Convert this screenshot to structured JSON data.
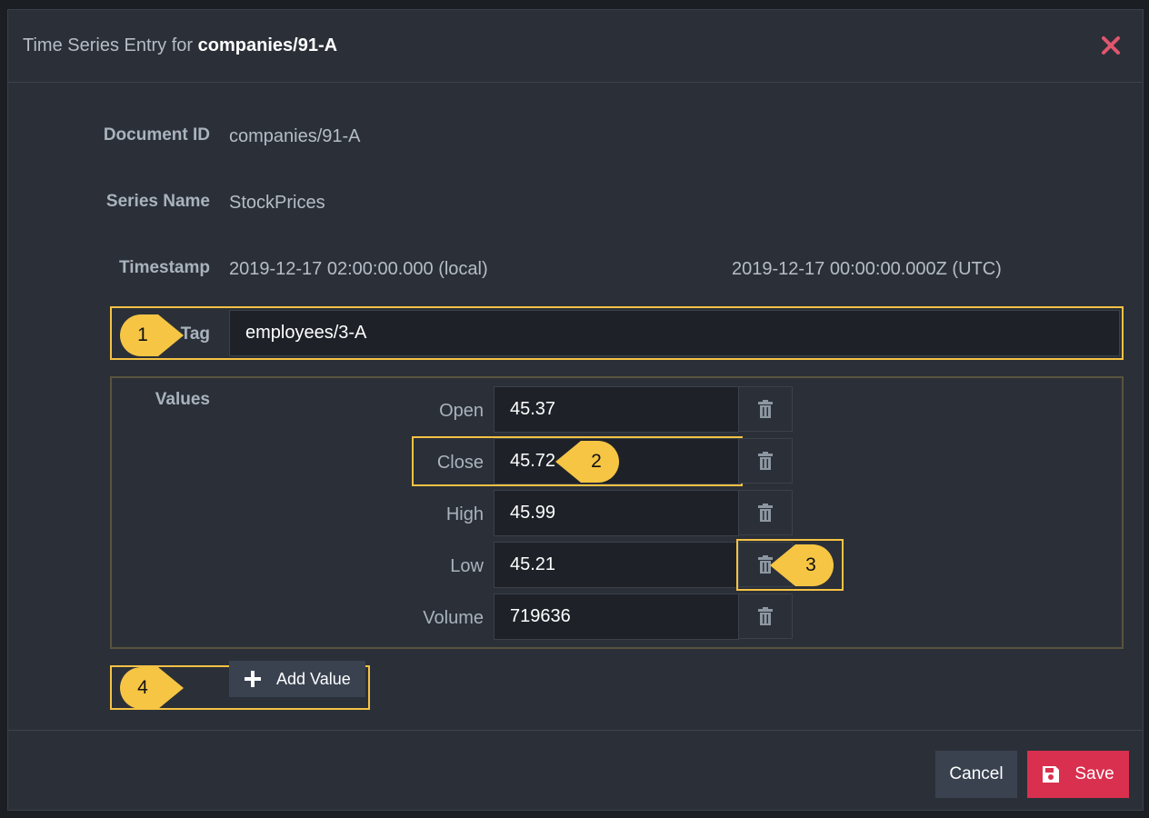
{
  "dialog": {
    "title_prefix": "Time Series Entry for",
    "title_doc": "companies/91-A",
    "close_icon": "close-icon"
  },
  "fields": {
    "document_id_label": "Document ID",
    "document_id_value": "companies/91-A",
    "series_name_label": "Series Name",
    "series_name_value": "StockPrices",
    "timestamp_label": "Timestamp",
    "timestamp_local": "2019-12-17 02:00:00.000 (local)",
    "timestamp_utc": "2019-12-17 00:00:00.000Z (UTC)",
    "tag_label": "Tag",
    "tag_value": "employees/3-A"
  },
  "values": {
    "label": "Values",
    "items": [
      {
        "name": "Open",
        "value": "45.37"
      },
      {
        "name": "Close",
        "value": "45.72"
      },
      {
        "name": "High",
        "value": "45.99"
      },
      {
        "name": "Low",
        "value": "45.21"
      },
      {
        "name": "Volume",
        "value": "719636"
      }
    ]
  },
  "actions": {
    "add_value_label": "Add Value",
    "cancel_label": "Cancel",
    "save_label": "Save"
  },
  "callouts": [
    "1",
    "2",
    "3",
    "4"
  ],
  "colors": {
    "accent_highlight": "#f5c244",
    "save": "#d9304f",
    "close": "#e0566f"
  }
}
